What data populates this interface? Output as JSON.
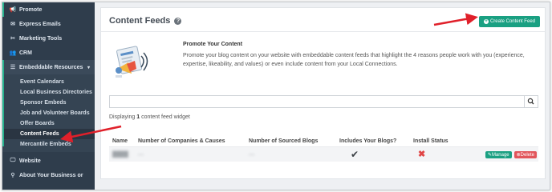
{
  "sidebar": {
    "items_top": [
      {
        "label": "Promote",
        "icon": "megaphone-icon",
        "glyph": "📢"
      },
      {
        "label": "Express Emails",
        "icon": "envelope-icon",
        "glyph": "✉"
      },
      {
        "label": "Marketing Tools",
        "icon": "tools-icon",
        "glyph": "✂"
      },
      {
        "label": "CRM",
        "icon": "users-icon",
        "glyph": "👥"
      }
    ],
    "parent": {
      "label": "Embeddable Resources",
      "icon": "list-icon",
      "glyph": "☰",
      "caret": "▾"
    },
    "subitems": [
      {
        "label": "Event Calendars",
        "active": false
      },
      {
        "label": "Local Business Directories",
        "active": false
      },
      {
        "label": "Sponsor Embeds",
        "active": false
      },
      {
        "label": "Job and Volunteer Boards",
        "active": false
      },
      {
        "label": "Offer Boards",
        "active": false
      },
      {
        "label": "Content Feeds",
        "active": true
      },
      {
        "label": "Mercantile Embeds",
        "active": false
      }
    ],
    "items_bottom": [
      {
        "label": "Website",
        "icon": "monitor-icon",
        "glyph": "🖵"
      },
      {
        "label": "About Your Business or",
        "icon": "location-icon",
        "glyph": "⚲"
      }
    ]
  },
  "header": {
    "title": "Content Feeds",
    "help_glyph": "?",
    "create_label": "Create Content Feed",
    "create_glyph": "+"
  },
  "promo": {
    "title": "Promote Your Content",
    "text": "Promote your blog content on your website with embeddable content feeds that highlight the 4 reasons people work with you (experience, expertise, likeability, and values) or even include content from your Local Connections."
  },
  "search": {
    "value": "",
    "icon_glyph": "⚲"
  },
  "display": {
    "prefix": "Displaying ",
    "count": "1",
    "suffix": " content feed widget"
  },
  "table": {
    "headers": [
      "Name",
      "Number of Companies & Causes",
      "Number of Sourced Blogs",
      "Includes Your Blogs?",
      "Install Status"
    ],
    "row": {
      "name": "████",
      "companies": "—",
      "blogs": "—",
      "includes_glyph": "✔",
      "status_glyph": "✖",
      "manage_label": "Manage",
      "delete_label": "Delete",
      "manage_glyph": "✎",
      "delete_glyph": "⊗"
    }
  },
  "colors": {
    "accent": "#1aa082",
    "danger": "#e2555b",
    "arrow": "#e0202a",
    "sidebar_bg": "#2f3d4c"
  }
}
